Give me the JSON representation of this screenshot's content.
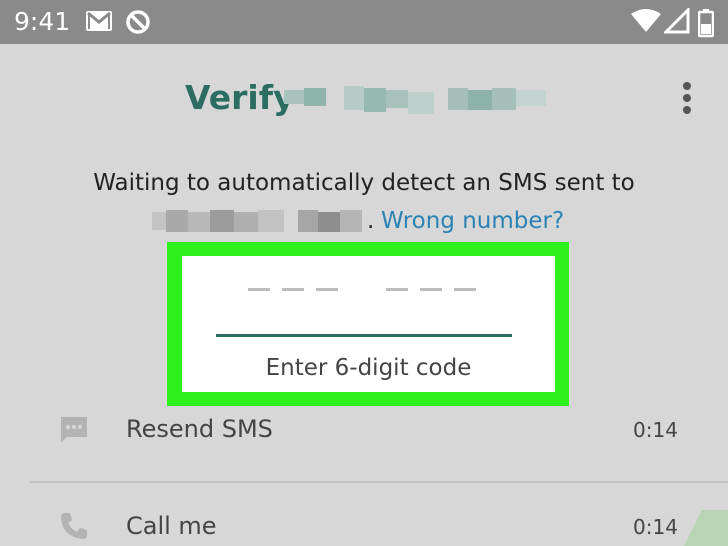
{
  "status_bar": {
    "time": "9:41"
  },
  "header": {
    "title_prefix": "Verify",
    "menu_icon": "more-vert-icon"
  },
  "message": {
    "waiting_text": "Waiting to automatically detect an SMS sent to",
    "dot": ".",
    "wrong_number_link": "Wrong number?"
  },
  "code_entry": {
    "hint": "Enter 6-digit code",
    "digit_count": 6,
    "accent_color": "#2b6e61",
    "highlight_color": "#2ff01d"
  },
  "options": [
    {
      "label": "Resend SMS",
      "timer": "0:14",
      "icon": "message-icon"
    },
    {
      "label": "Call me",
      "timer": "0:14",
      "icon": "phone-icon"
    }
  ]
}
